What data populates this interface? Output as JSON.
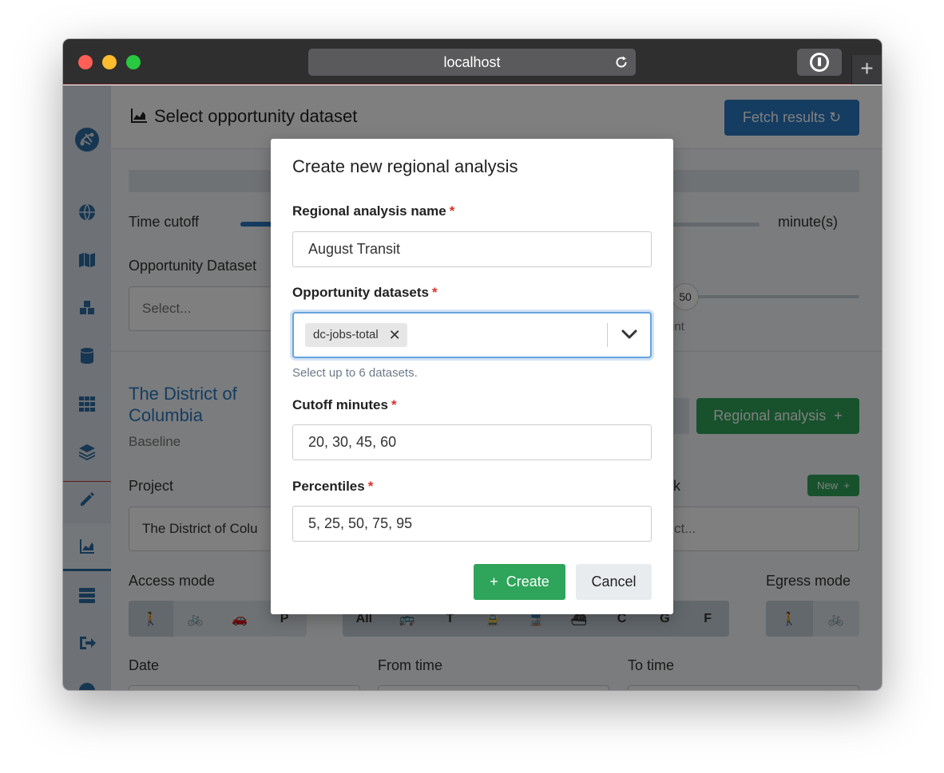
{
  "browser": {
    "url": "localhost"
  },
  "background": {
    "header_title": "Select opportunity dataset",
    "fetch_button": "Fetch results",
    "time_cutoff_label": "Time cutoff",
    "time_unit": "minute(s)",
    "opportunity_dataset_label": "Opportunity Dataset",
    "select_placeholder": "Select...",
    "percentile_value": "50",
    "percentile_suffix": "int",
    "region_name": "The District of Columbia",
    "scenario": "Baseline",
    "regional_analysis_button": "Regional analysis",
    "project_label": "Project",
    "project_value": "The District of Colu",
    "bookmark_label": "ark",
    "new_badge": "New",
    "bookmark_placeholder": "ct...",
    "access_mode_label": "Access mode",
    "egress_mode_label": "Egress mode",
    "access_modes": [
      "walk",
      "bike",
      "car",
      "P"
    ],
    "transit_modes": [
      "All",
      "bus",
      "T",
      "tram",
      "rail",
      "ferry",
      "C",
      "G",
      "F"
    ],
    "date_label": "Date",
    "from_time_label": "From time",
    "to_time_label": "To time"
  },
  "modal": {
    "title": "Create new regional analysis",
    "name_label": "Regional analysis name",
    "name_value": "August Transit",
    "datasets_label": "Opportunity datasets",
    "selected_dataset": "dc-jobs-total",
    "datasets_help": "Select up to 6 datasets.",
    "cutoff_label": "Cutoff minutes",
    "cutoff_value": "20, 30, 45, 60",
    "percentiles_label": "Percentiles",
    "percentiles_value": "5, 25, 50, 75, 95",
    "create_button": "Create",
    "cancel_button": "Cancel",
    "required_marker": "*"
  },
  "colors": {
    "primary": "#2b79c2",
    "success": "#2ea55a",
    "danger": "#d9302c"
  }
}
